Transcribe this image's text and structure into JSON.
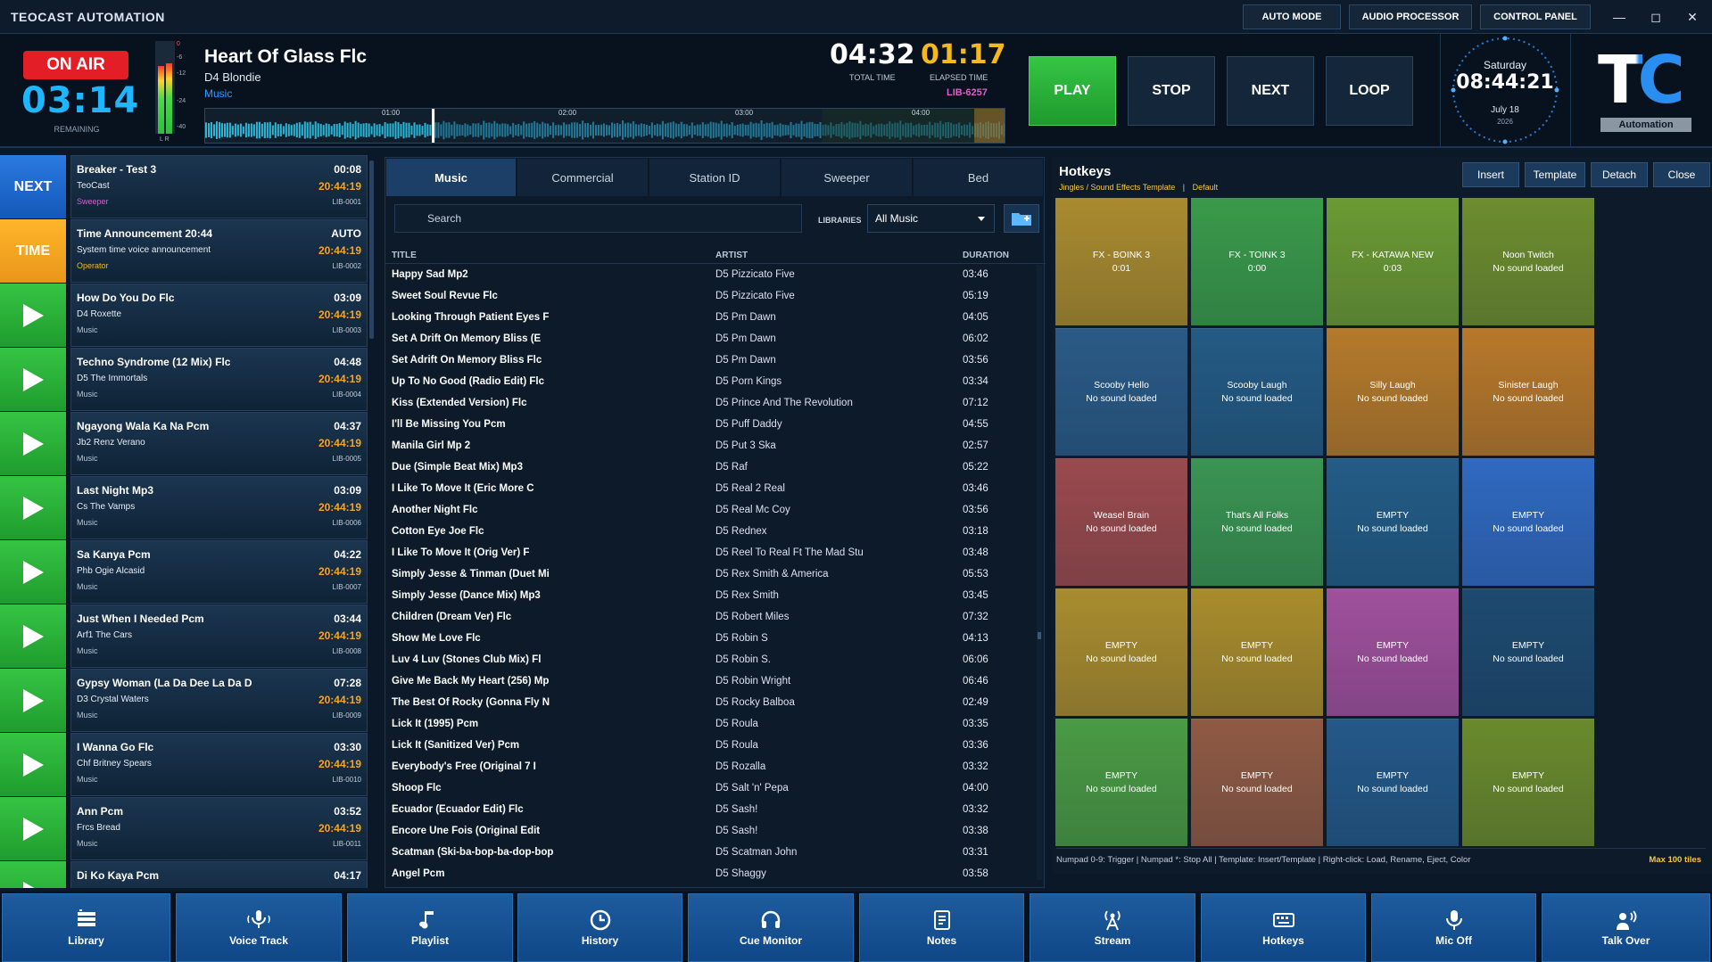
{
  "app": {
    "title": "TEOCAST AUTOMATION"
  },
  "titlebar": {
    "buttons": [
      "AUTO MODE",
      "AUDIO PROCESSOR",
      "CONTROL PANEL"
    ],
    "min": "—",
    "max": "◻",
    "close": "✕"
  },
  "onair": {
    "label": "ON AIR",
    "remaining": "03:14",
    "remaining_label": "REMAINING"
  },
  "vu": {
    "ticks": [
      "0",
      "-6",
      "-12",
      "-24",
      "-40"
    ],
    "lr": "L R",
    "left_level": 0.84,
    "right_level": 0.88
  },
  "now_playing": {
    "title": "Heart Of Glass Flc",
    "artist": "D4 Blondie",
    "category": "Music",
    "total_time": "04:32",
    "total_label": "TOTAL TIME",
    "elapsed_time": "01:17",
    "elapsed_label": "ELAPSED TIME",
    "lib_id": "LIB-6257",
    "wave_ticks": [
      "01:00",
      "02:00",
      "03:00",
      "04:00"
    ],
    "progress": 0.283
  },
  "controls": {
    "play": "PLAY",
    "stop": "STOP",
    "next": "NEXT",
    "loop": "LOOP"
  },
  "clock": {
    "day": "Saturday",
    "time": "08:44:21",
    "date": "July 18",
    "year": "2026"
  },
  "logo": {
    "mark": "TC",
    "text": "Automation"
  },
  "playlist": [
    {
      "btn": "NEXT",
      "title": "Breaker - Test 3",
      "artist": "TeoCast",
      "category": "Sweeper",
      "duration": "00:08",
      "start": "20:44:19",
      "lib": "LIB-0001"
    },
    {
      "btn": "TIME",
      "title": "Time Announcement 20:44",
      "artist": "System time voice announcement",
      "category": "Operator",
      "duration": "AUTO",
      "start": "20:44:19",
      "lib": "LIB-0002"
    },
    {
      "btn": "play",
      "title": "How Do You Do Flc",
      "artist": "D4 Roxette",
      "category": "Music",
      "duration": "03:09",
      "start": "20:44:19",
      "lib": "LIB-0003"
    },
    {
      "btn": "play",
      "title": "Techno Syndrome (12 Mix) Flc",
      "artist": "D5 The Immortals",
      "category": "Music",
      "duration": "04:48",
      "start": "20:44:19",
      "lib": "LIB-0004"
    },
    {
      "btn": "play",
      "title": "Ngayong Wala Ka Na Pcm",
      "artist": "Jb2 Renz Verano",
      "category": "Music",
      "duration": "04:37",
      "start": "20:44:19",
      "lib": "LIB-0005"
    },
    {
      "btn": "play",
      "title": "Last Night Mp3",
      "artist": "Cs The Vamps",
      "category": "Music",
      "duration": "03:09",
      "start": "20:44:19",
      "lib": "LIB-0006"
    },
    {
      "btn": "play",
      "title": "Sa Kanya Pcm",
      "artist": "Phb Ogie Alcasid",
      "category": "Music",
      "duration": "04:22",
      "start": "20:44:19",
      "lib": "LIB-0007"
    },
    {
      "btn": "play",
      "title": "Just When I Needed Pcm",
      "artist": "Arf1 The Cars",
      "category": "Music",
      "duration": "03:44",
      "start": "20:44:19",
      "lib": "LIB-0008"
    },
    {
      "btn": "play",
      "title": "Gypsy Woman (La Da Dee La Da D",
      "artist": "D3 Crystal Waters",
      "category": "Music",
      "duration": "07:28",
      "start": "20:44:19",
      "lib": "LIB-0009"
    },
    {
      "btn": "play",
      "title": "I Wanna Go Flc",
      "artist": "Chf Britney Spears",
      "category": "Music",
      "duration": "03:30",
      "start": "20:44:19",
      "lib": "LIB-0010"
    },
    {
      "btn": "play",
      "title": "Ann Pcm",
      "artist": "Frcs Bread",
      "category": "Music",
      "duration": "03:52",
      "start": "20:44:19",
      "lib": "LIB-0011"
    },
    {
      "btn": "play",
      "title": "Di Ko Kaya Pcm",
      "artist": "",
      "category": "",
      "duration": "04:17",
      "start": "",
      "lib": ""
    }
  ],
  "library": {
    "tabs": [
      "Music",
      "Commercial",
      "Station ID",
      "Sweeper",
      "Bed"
    ],
    "active_tab": 0,
    "search_placeholder": "Search",
    "libraries_label": "LIBRARIES",
    "libraries_value": "All Music",
    "columns": [
      "TITLE",
      "ARTIST",
      "DURATION"
    ],
    "rows": [
      [
        "Happy Sad Mp2",
        "D5 Pizzicato Five",
        "03:46"
      ],
      [
        "Sweet Soul Revue Flc",
        "D5 Pizzicato Five",
        "05:19"
      ],
      [
        "Looking Through Patient Eyes F",
        "D5 Pm Dawn",
        "04:05"
      ],
      [
        "Set A Drift On Memory Bliss (E",
        "D5 Pm Dawn",
        "06:02"
      ],
      [
        "Set Adrift On Memory Bliss Flc",
        "D5 Pm Dawn",
        "03:56"
      ],
      [
        "Up To No Good (Radio Edit) Flc",
        "D5 Porn Kings",
        "03:34"
      ],
      [
        "Kiss (Extended Version) Flc",
        "D5 Prince And The Revolution",
        "07:12"
      ],
      [
        "I'll Be Missing You Pcm",
        "D5 Puff Daddy",
        "04:55"
      ],
      [
        "Manila Girl Mp 2",
        "D5 Put 3 Ska",
        "02:57"
      ],
      [
        "Due (Simple Beat Mix) Mp3",
        "D5 Raf",
        "05:22"
      ],
      [
        "I Like To Move It (Eric More C",
        "D5 Real 2 Real",
        "03:46"
      ],
      [
        "Another Night Flc",
        "D5 Real Mc Coy",
        "03:56"
      ],
      [
        "Cotton Eye Joe Flc",
        "D5 Rednex",
        "03:18"
      ],
      [
        "I Like To Move It (Orig Ver) F",
        "D5 Reel To Real Ft The Mad Stu",
        "03:48"
      ],
      [
        "Simply Jesse & Tinman (Duet Mi",
        "D5 Rex Smith & America",
        "05:53"
      ],
      [
        "Simply Jesse (Dance Mix) Mp3",
        "D5 Rex Smith",
        "03:45"
      ],
      [
        "Children (Dream Ver) Flc",
        "D5 Robert Miles",
        "07:32"
      ],
      [
        "Show Me Love Flc",
        "D5 Robin S",
        "04:13"
      ],
      [
        "Luv 4 Luv (Stones Club Mix) Fl",
        "D5 Robin S.",
        "06:06"
      ],
      [
        "Give Me Back My Heart (256) Mp",
        "D5 Robin Wright",
        "06:46"
      ],
      [
        "The Best Of Rocky (Gonna Fly N",
        "D5 Rocky Balboa",
        "02:49"
      ],
      [
        "Lick It (1995) Pcm",
        "D5 Roula",
        "03:35"
      ],
      [
        "Lick It (Sanitized Ver) Pcm",
        "D5 Roula",
        "03:36"
      ],
      [
        "Everybody's Free (Original 7 I",
        "D5 Rozalla",
        "03:32"
      ],
      [
        "Shoop Flc",
        "D5 Salt 'n' Pepa",
        "04:00"
      ],
      [
        "Ecuador (Ecuador Edit) Flc",
        "D5 Sash!",
        "03:32"
      ],
      [
        "Encore Une Fois (Original Edit",
        "D5 Sash!",
        "03:38"
      ],
      [
        "Scatman (Ski-ba-bop-ba-dop-bop",
        "D5 Scatman John",
        "03:31"
      ],
      [
        "Angel Pcm",
        "D5 Shaggy",
        "03:58"
      ]
    ]
  },
  "hotkeys": {
    "title": "Hotkeys",
    "subtitle": "Jingles / Sound Effects Template",
    "template_name": "Default",
    "sep": "|",
    "buttons": [
      "Insert",
      "Template",
      "Detach",
      "Close"
    ],
    "tiles": [
      {
        "l1": "FX -  BOINK 3",
        "l2": "0:01",
        "color": "#a98a2e"
      },
      {
        "l1": "FX -  TOINK 3",
        "l2": "0:00",
        "color": "#3a9a4a"
      },
      {
        "l1": "FX -  KATAWA NEW",
        "l2": "0:03",
        "color": "#6b9a33"
      },
      {
        "l1": "Noon Twitch",
        "l2": "No sound loaded",
        "color": "#6d8d2e"
      },
      {
        "l1": "Scooby Hello",
        "l2": "No sound loaded",
        "color": "#2a5a86"
      },
      {
        "l1": "Scooby Laugh",
        "l2": "No sound loaded",
        "color": "#245a84"
      },
      {
        "l1": "Silly Laugh",
        "l2": "No sound loaded",
        "color": "#b57a2a"
      },
      {
        "l1": "Sinister Laugh",
        "l2": "No sound loaded",
        "color": "#b8782a"
      },
      {
        "l1": "Weasel Brain",
        "l2": "No sound loaded",
        "color": "#9a4a4e"
      },
      {
        "l1": "That's All Folks",
        "l2": "No sound loaded",
        "color": "#3a9452"
      },
      {
        "l1": "EMPTY",
        "l2": "No sound loaded",
        "color": "#235c86"
      },
      {
        "l1": "EMPTY",
        "l2": "No sound loaded",
        "color": "#3069c0"
      },
      {
        "l1": "EMPTY",
        "l2": "No sound loaded",
        "color": "#a98c2e"
      },
      {
        "l1": "EMPTY",
        "l2": "No sound loaded",
        "color": "#a98c2c"
      },
      {
        "l1": "EMPTY",
        "l2": "No sound loaded",
        "color": "#a0509c"
      },
      {
        "l1": "EMPTY",
        "l2": "No sound loaded",
        "color": "#1e4a70"
      },
      {
        "l1": "EMPTY",
        "l2": "No sound loaded",
        "color": "#4a9a44"
      },
      {
        "l1": "EMPTY",
        "l2": "No sound loaded",
        "color": "#8f5a44"
      },
      {
        "l1": "EMPTY",
        "l2": "No sound loaded",
        "color": "#245888"
      },
      {
        "l1": "EMPTY",
        "l2": "No sound loaded",
        "color": "#6a8a2c"
      }
    ],
    "footer": "Numpad 0-9: Trigger   |   Numpad *: Stop All   |   Template: Insert/Template   |   Right-click: Load, Rename, Eject, Color",
    "max": "Max 100 tiles"
  },
  "bottom_nav": [
    {
      "label": "Library",
      "icon": "library-icon"
    },
    {
      "label": "Voice Track",
      "icon": "voice-track-icon"
    },
    {
      "label": "Playlist",
      "icon": "playlist-icon"
    },
    {
      "label": "History",
      "icon": "history-icon"
    },
    {
      "label": "Cue Monitor",
      "icon": "headphones-icon"
    },
    {
      "label": "Notes",
      "icon": "notes-icon"
    },
    {
      "label": "Stream",
      "icon": "stream-icon"
    },
    {
      "label": "Hotkeys",
      "icon": "keyboard-icon"
    },
    {
      "label": "Mic Off",
      "icon": "mic-icon"
    },
    {
      "label": "Talk Over",
      "icon": "talk-over-icon"
    }
  ],
  "colors": {
    "accent": "#1fb6ff",
    "onair": "#e41e26",
    "play": "#2dac3a",
    "next": "#1769d0",
    "time": "#f5a81e",
    "amber": "#f5a623"
  }
}
